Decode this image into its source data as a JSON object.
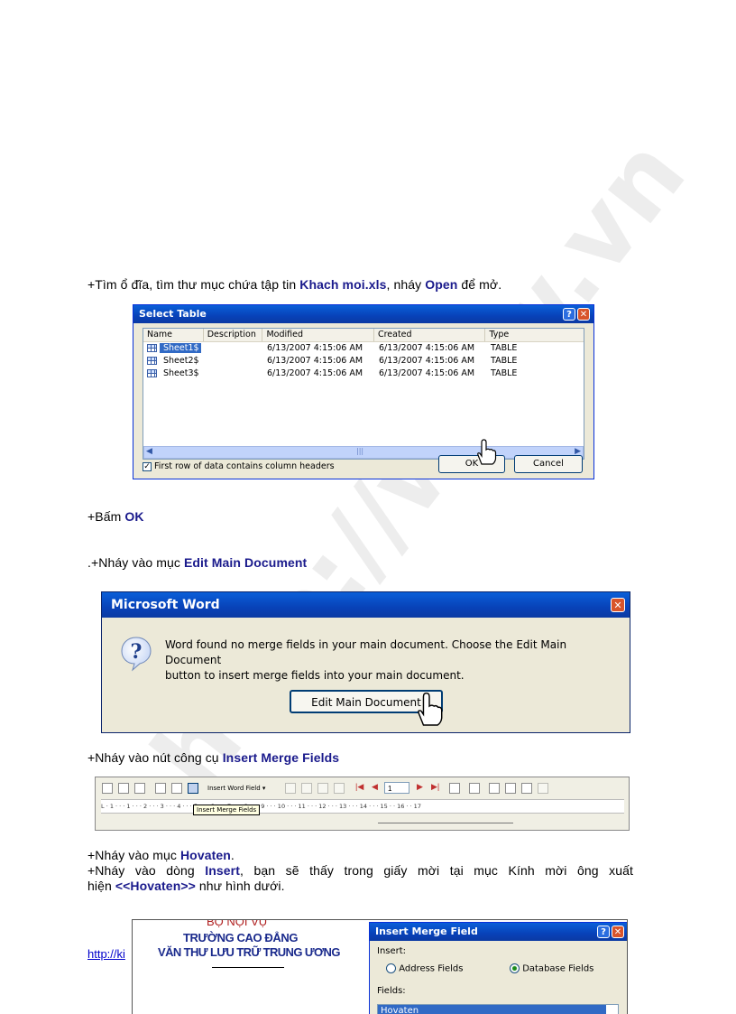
{
  "step1": {
    "prefix": "+Tìm ổ đĩa, tìm thư mục chứa tập tin ",
    "file": "Khach moi.xls",
    "middle": ", nháy ",
    "action": "Open",
    "suffix": " để mở."
  },
  "select_table": {
    "title": "Select Table",
    "columns": [
      "Name",
      "Description",
      "Modified",
      "Created",
      "Type"
    ],
    "rows": [
      {
        "name": "Sheet1$",
        "description": "",
        "modified": "6/13/2007 4:15:06 AM",
        "created": "6/13/2007 4:15:06 AM",
        "type": "TABLE"
      },
      {
        "name": "Sheet2$",
        "description": "",
        "modified": "6/13/2007 4:15:06 AM",
        "created": "6/13/2007 4:15:06 AM",
        "type": "TABLE"
      },
      {
        "name": "Sheet3$",
        "description": "",
        "modified": "6/13/2007 4:15:06 AM",
        "created": "6/13/2007 4:15:06 AM",
        "type": "TABLE"
      }
    ],
    "checkbox_label": "First row of data contains column headers",
    "ok_label": "OK",
    "cancel_label": "Cancel"
  },
  "step2": {
    "prefix": "+Bấm ",
    "action": "OK"
  },
  "step3": {
    "prefix": ".+Nháy vào mục ",
    "action": "Edit Main Document"
  },
  "msword": {
    "title": "Microsoft Word",
    "message_line1": "Word found no merge fields in your main document. Choose the Edit Main Document",
    "message_line2": "button to insert merge fields into your main document.",
    "button_label": "Edit Main Document"
  },
  "step4": {
    "prefix": "+Nháy vào nút công cụ ",
    "action": "Insert Merge Fields"
  },
  "toolbar": {
    "insert_word_field": "Insert Word Field ▾",
    "record_number": "1",
    "tooltip": "Insert Merge Fields",
    "ruler_text": "L · 1 · · · 1 · · · 2 · · · 3 · · · 4 · · · 5 · · · 6 · · · 7 · · · 8 · · · 9 · · · 10 · · · 11 · · · 12 · · · 13 · · · 14 · · · 15 · · 16 · · 17"
  },
  "step5": {
    "prefix": "+Nháy vào mục ",
    "action": "Hovaten",
    "suffix": "."
  },
  "step6": {
    "prefix": "+Nháy vào dòng ",
    "action": "Insert",
    "middle": ", bạn sẽ thấy trong giấy mời tại mục Kính  mời ông xuất",
    "line2_prefix": "hiện ",
    "field": "<<Hovaten>>",
    "line2_suffix": " như hình  dưới."
  },
  "invitation": {
    "ministry": "BỘ NỘI VỤ",
    "school_line1": "TRƯỜNG CAO ĐẲNG",
    "school_line2": "VĂN THƯ LƯU TRỮ TRUNG ƯƠNG"
  },
  "merge_dialog": {
    "title": "Insert Merge Field",
    "insert_label": "Insert:",
    "address_fields": "Address Fields",
    "database_fields": "Database Fields",
    "fields_label": "Fields:",
    "selected_field": "Hovaten"
  },
  "footer_link": "http://ki",
  "watermark": "http://www.vn"
}
